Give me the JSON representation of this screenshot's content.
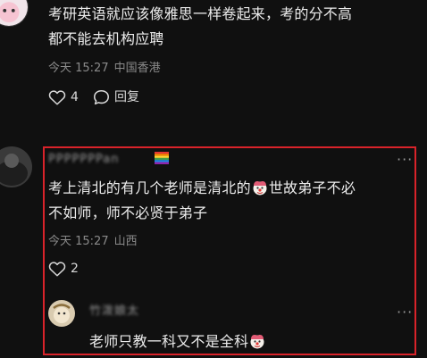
{
  "comment1": {
    "text_line1": "考研英语就应该像雅思一样卷起来，考的分不高",
    "text_line2": "都不能去机构应聘",
    "time": "今天 15:27",
    "location": "中国香港",
    "like_count": "4",
    "reply_label": "回复"
  },
  "comment2": {
    "username": "PPPPPPPan",
    "text_line1_a": "考上清北的有几个老师是清北的",
    "text_line1_b": "世故弟子不必",
    "text_line2": "不如师，师不必贤于弟子",
    "time": "今天 15:27",
    "location": "山西",
    "like_count": "2",
    "more_label": "···"
  },
  "reply1": {
    "username": "竹泼娘太",
    "text": "老师只教一科又不是全科",
    "more_label": "···"
  },
  "colors": {
    "background": "#101010",
    "highlight_border": "#d9232a"
  }
}
